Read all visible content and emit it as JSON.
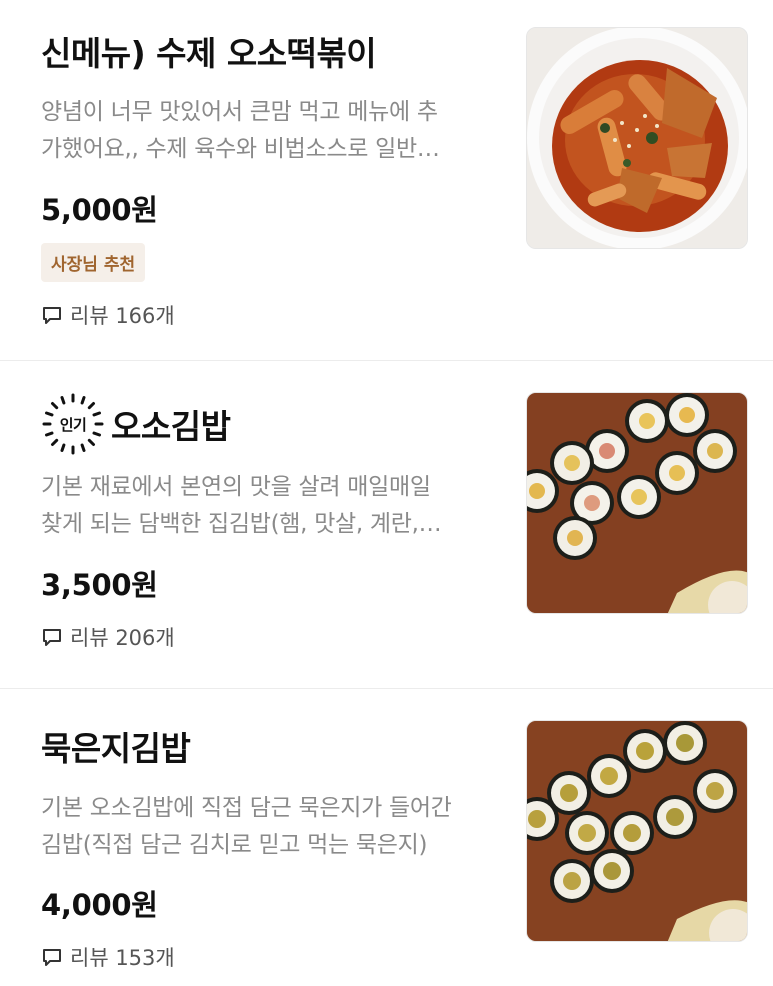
{
  "items": [
    {
      "name": "신메뉴) 수제 오소떡볶이",
      "desc_line1": "양념이 너무 맛있어서 큰맘 먹고 메뉴에 추",
      "desc_line2": "가했어요,, 수제 육수와 비법소스로 일반…",
      "price": "5,000원",
      "badge": "사장님 추천",
      "review": "리뷰 166개",
      "image": "tteokbokki-photo"
    },
    {
      "popular_label": "인기",
      "name": "오소김밥",
      "desc_line1": "기본 재료에서 본연의 맛을 살려 매일매일",
      "desc_line2": "찾게 되는 담백한 집김밥(햄, 맛살, 계란,…",
      "price": "3,500원",
      "review": "리뷰 206개",
      "image": "gimbap-photo"
    },
    {
      "name": "묵은지김밥",
      "desc_line1": "기본 오소김밥에 직접 담근 묵은지가 들어간",
      "desc_line2": "김밥(직접 담근 김치로 믿고 먹는 묵은지)",
      "price": "4,000원",
      "review": "리뷰 153개",
      "image": "kimchi-gimbap-photo"
    }
  ],
  "colors": {
    "badge_bg": "#f5efe9",
    "badge_text": "#a0652f",
    "desc_text": "#8a8a8a"
  },
  "icons": {
    "review": "speech-bubble-icon",
    "popular": "popular-burst-icon"
  }
}
